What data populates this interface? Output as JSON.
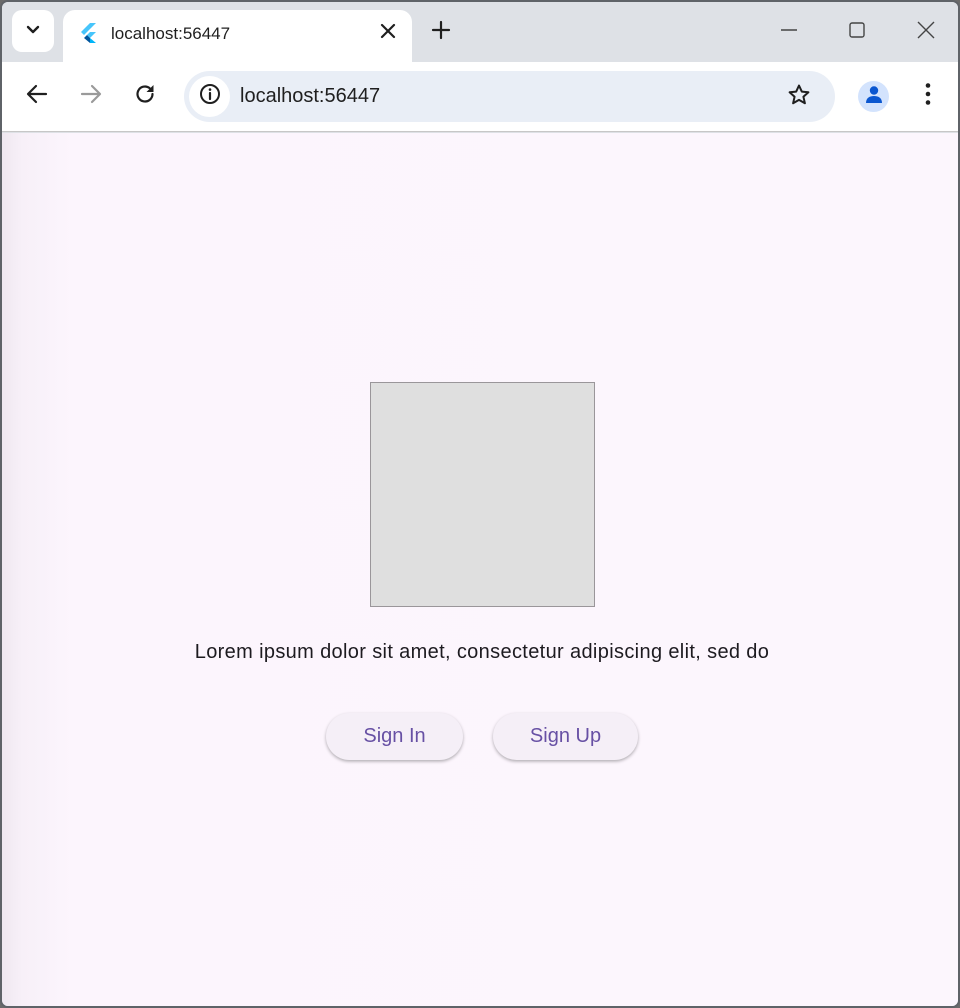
{
  "browser": {
    "tab": {
      "title": "localhost:56447"
    },
    "address_bar": {
      "url": "localhost:56447"
    },
    "icons": {
      "tab_search": "chevron-down-icon",
      "tab_close": "close-icon",
      "new_tab": "plus-icon",
      "minimize": "minimize-icon",
      "maximize": "maximize-icon",
      "close_window": "close-icon",
      "back": "arrow-left-icon",
      "forward": "arrow-right-icon",
      "reload": "reload-icon",
      "site_info": "info-icon",
      "bookmark": "star-icon",
      "profile": "person-icon",
      "menu": "kebab-menu-icon"
    }
  },
  "page": {
    "description": "Lorem ipsum dolor sit amet, consectetur adipiscing elit, sed do",
    "buttons": {
      "sign_in": "Sign In",
      "sign_up": "Sign Up"
    }
  },
  "colors": {
    "background": "#fcf6fd",
    "button_bg": "#f5eff7",
    "button_text": "#6750a4",
    "placeholder": "#dfdfdf"
  }
}
